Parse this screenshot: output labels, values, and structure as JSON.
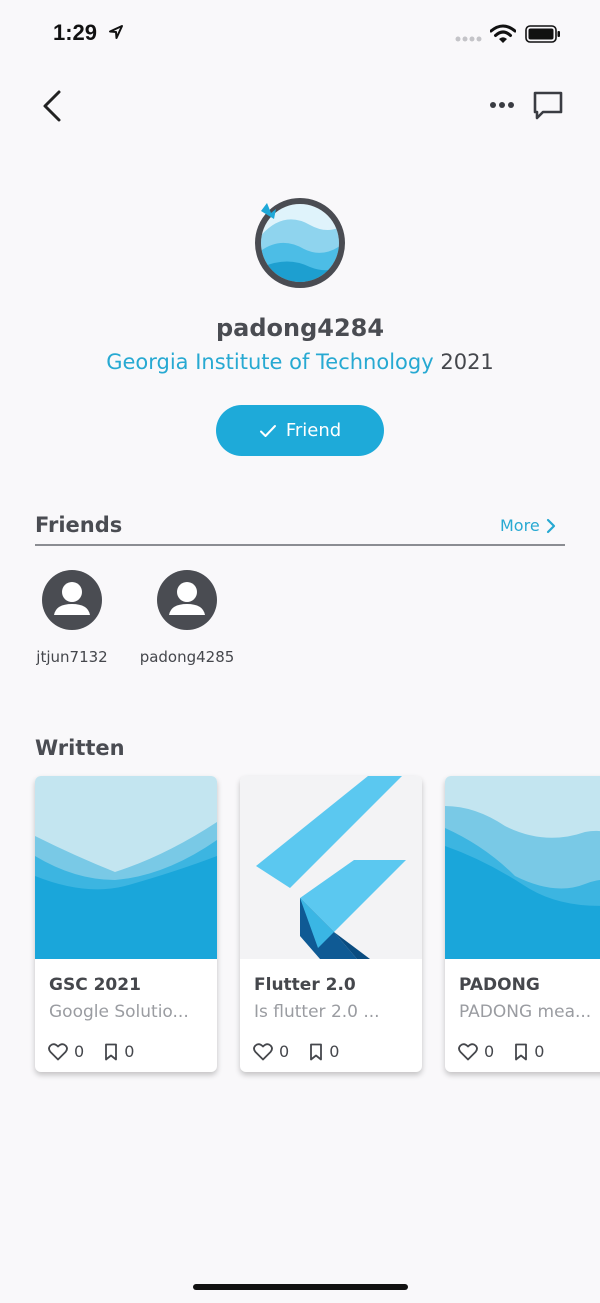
{
  "status_bar": {
    "time": "1:29"
  },
  "profile": {
    "username": "padong4284",
    "school": "Georgia Institute of Technology",
    "year": "2021",
    "friend_button_label": "Friend"
  },
  "friends_section": {
    "title": "Friends",
    "more_label": "More",
    "friends": [
      {
        "name": "jtjun7132"
      },
      {
        "name": "padong4285"
      }
    ]
  },
  "written_section": {
    "title": "Written",
    "cards": [
      {
        "title": "GSC 2021",
        "description": "Google Solutio...",
        "likes": "0",
        "bookmarks": "0",
        "thumbnail": "waves-image"
      },
      {
        "title": "Flutter 2.0",
        "description": "Is flutter 2.0 ...",
        "likes": "0",
        "bookmarks": "0",
        "thumbnail": "flutter-logo"
      },
      {
        "title": "PADONG",
        "description": "PADONG mea...",
        "likes": "0",
        "bookmarks": "0",
        "thumbnail": "waves-image"
      }
    ]
  },
  "colors": {
    "accent": "#1eaad9",
    "text": "#45474c",
    "muted": "#9a9ca1",
    "background": "#f9f8fa"
  }
}
